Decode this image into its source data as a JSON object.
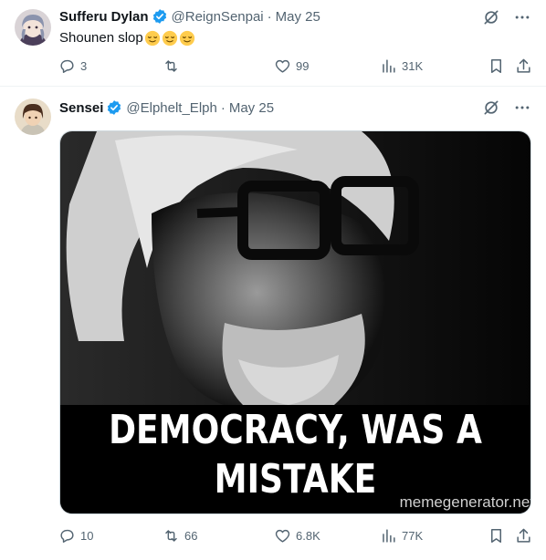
{
  "tweets": [
    {
      "display_name": "Sufferu Dylan",
      "handle": "@ReignSenpai",
      "separator": "·",
      "date": "May 25",
      "text": "Shounen slop",
      "emojis": [
        "relieved-face",
        "relieved-face",
        "relieved-face"
      ],
      "stats": {
        "replies": "3",
        "retweets": "",
        "likes": "99",
        "views": "31K"
      }
    },
    {
      "display_name": "Sensei",
      "handle": "@Elphelt_Elph",
      "separator": "·",
      "date": "May 25",
      "media": {
        "line1": "DEMOCRACY,  WAS A",
        "line2": "MISTAKE",
        "watermark": "memegenerator.net"
      },
      "stats": {
        "replies": "10",
        "retweets": "66",
        "likes": "6.8K",
        "views": "77K"
      }
    }
  ],
  "colors": {
    "verified": "#1d9bf0",
    "muted": "#536471",
    "text": "#0f1419"
  },
  "icons": [
    "grok-icon",
    "more-icon",
    "reply-icon",
    "retweet-icon",
    "like-icon",
    "views-icon",
    "bookmark-icon",
    "share-icon"
  ]
}
